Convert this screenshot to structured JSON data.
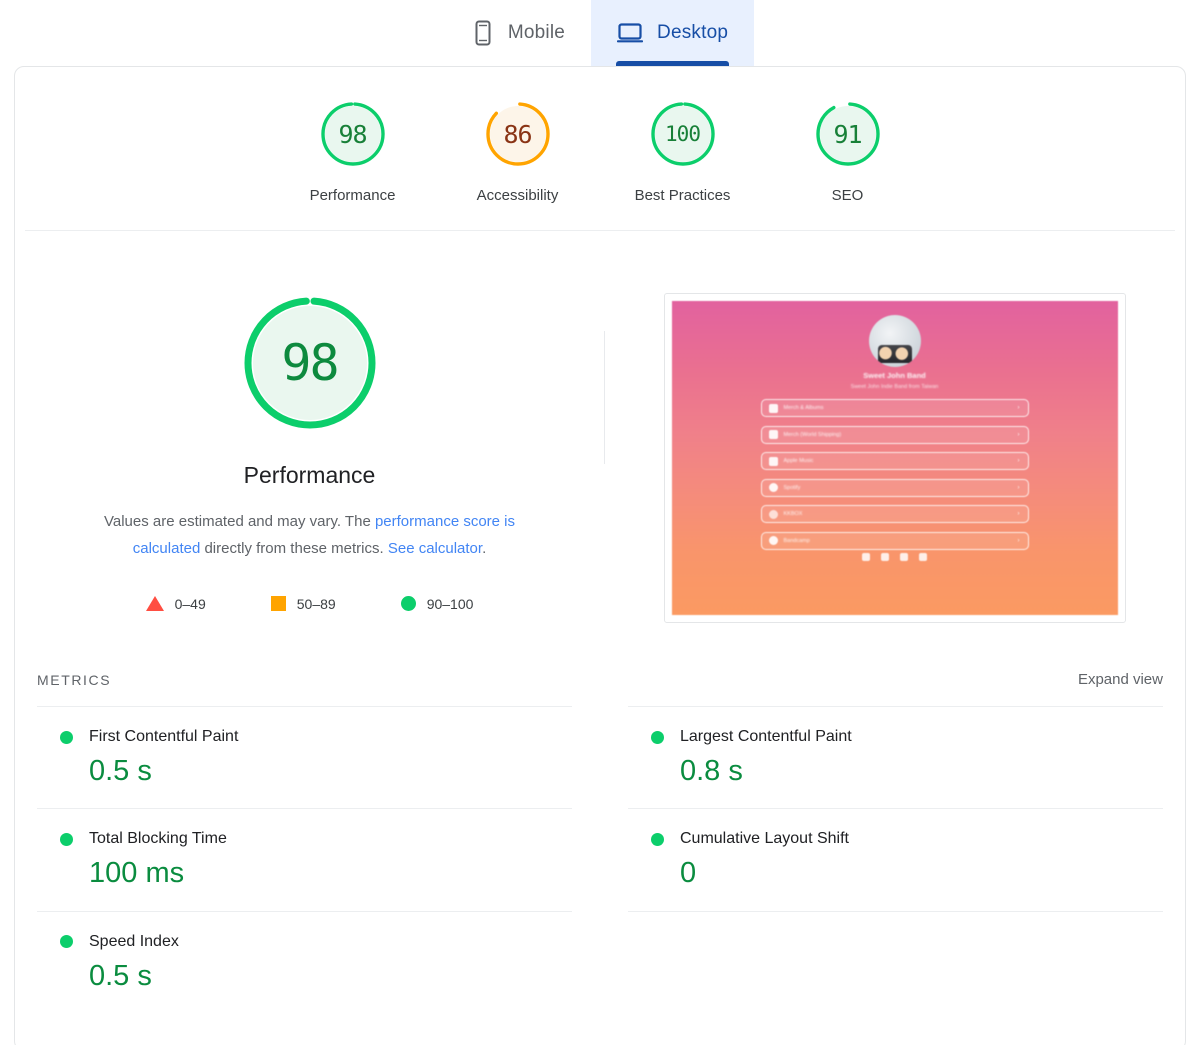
{
  "tabs": [
    {
      "label": "Mobile",
      "icon": "mobile-phone-icon",
      "active": false
    },
    {
      "label": "Desktop",
      "icon": "desktop-monitor-icon",
      "active": true
    }
  ],
  "category_scores": [
    {
      "label": "Performance",
      "score": 98,
      "color": "#0cce6b",
      "text_color": "#188038",
      "fill": "#e9f7ef"
    },
    {
      "label": "Accessibility",
      "score": 86,
      "color": "#ffa400",
      "text_color": "#8a3415",
      "fill": "#fdf5e9"
    },
    {
      "label": "Best Practices",
      "score": 100,
      "color": "#0cce6b",
      "text_color": "#188038",
      "fill": "#e9f7ef"
    },
    {
      "label": "SEO",
      "score": 91,
      "color": "#0cce6b",
      "text_color": "#188038",
      "fill": "#e9f7ef"
    }
  ],
  "hero": {
    "score": 98,
    "title": "Performance",
    "color": "#0cce6b",
    "text_color": "#0d8a3e",
    "fill": "#eaf7ef",
    "description_parts": {
      "p1": "Values are estimated and may vary. The ",
      "link1": "performance score is calculated",
      "p2": " directly from these metrics. ",
      "link2": "See calculator",
      "p3": "."
    }
  },
  "legend": [
    {
      "shape": "triangle",
      "range": "0–49",
      "color": "#ff4e42"
    },
    {
      "shape": "square",
      "range": "50–89",
      "color": "#ffa400"
    },
    {
      "shape": "circle",
      "range": "90–100",
      "color": "#0cce6b"
    }
  ],
  "thumbnail": {
    "name": "Sweet John Band",
    "subtitle": "Sweet John Indie Band from Taiwan",
    "links": [
      {
        "label": "Merch & Albums",
        "icon": "bag-icon"
      },
      {
        "label": "Merch (World Shipping)",
        "icon": "x-icon"
      },
      {
        "label": "Apple Music",
        "icon": "music-note-icon"
      },
      {
        "label": "Spotify",
        "icon": "spotify-icon"
      },
      {
        "label": "KKBOX",
        "icon": "kkbox-icon"
      },
      {
        "label": "Bandcamp",
        "icon": "bandcamp-icon"
      }
    ],
    "social": [
      "instagram-icon",
      "youtube-icon",
      "facebook-icon",
      "weibo-icon"
    ]
  },
  "metrics_section": {
    "title": "METRICS",
    "expand_label": "Expand view",
    "items": [
      {
        "name": "First Contentful Paint",
        "value": "0.5 s",
        "status": "pass",
        "color": "#0cce6b"
      },
      {
        "name": "Largest Contentful Paint",
        "value": "0.8 s",
        "status": "pass",
        "color": "#0cce6b"
      },
      {
        "name": "Total Blocking Time",
        "value": "100 ms",
        "status": "pass",
        "color": "#0cce6b"
      },
      {
        "name": "Cumulative Layout Shift",
        "value": "0",
        "status": "pass",
        "color": "#0cce6b"
      },
      {
        "name": "Speed Index",
        "value": "0.5 s",
        "status": "pass",
        "color": "#0cce6b"
      }
    ]
  }
}
